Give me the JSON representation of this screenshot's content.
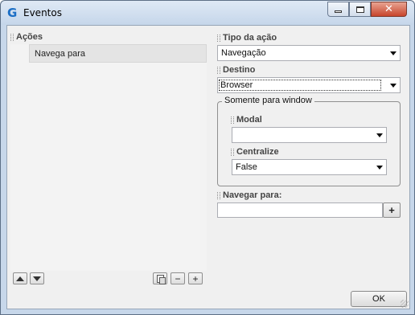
{
  "window": {
    "title": "Eventos",
    "icon": "g-logo-icon",
    "close_glyph": "✕"
  },
  "actions_panel": {
    "header": "Ações",
    "items": [
      {
        "label": "Navega  para"
      }
    ],
    "toolbar": {
      "move_up_icon": "triangle-up-icon",
      "move_down_icon": "triangle-down-icon",
      "copy_icon": "copy-icon",
      "remove_label": "−",
      "add_label": "+"
    }
  },
  "properties": {
    "tipo_label": "Tipo da ação",
    "tipo_value": "Navegação",
    "destino_label": "Destino",
    "destino_value": "Browser",
    "group_title": "Somente para window",
    "modal_label": "Modal",
    "modal_value": "",
    "centralize_label": "Centralize",
    "centralize_value": "False",
    "navegar_label": "Navegar para:",
    "navegar_value": "",
    "navegar_add_label": "+"
  },
  "footer": {
    "ok_label": "OK"
  },
  "colors": {
    "accent": "#1c6fc5",
    "frame": "#c7d7ea",
    "client_bg": "#f0f0f0",
    "close_button": "#c8452c"
  }
}
